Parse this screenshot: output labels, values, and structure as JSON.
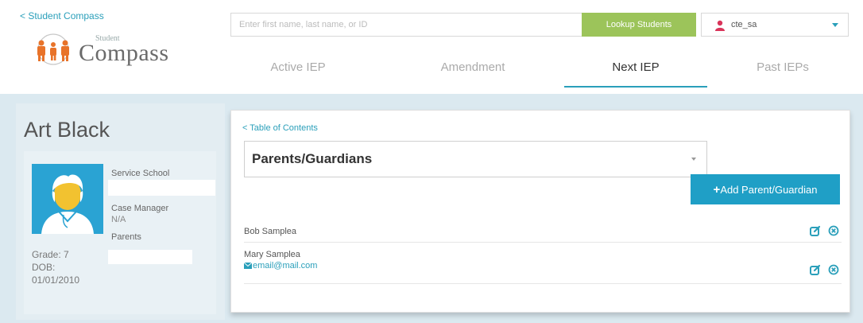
{
  "header": {
    "back_link": "< Student Compass",
    "logo_small": "Student",
    "logo_big": "Compass",
    "search_placeholder": "Enter first name, last name, or ID",
    "lookup_label": "Lookup Students",
    "user_name": "cte_sa"
  },
  "tabs": [
    {
      "label": "Active IEP"
    },
    {
      "label": "Amendment"
    },
    {
      "label": "Next IEP",
      "active": true
    },
    {
      "label": "Past IEPs"
    }
  ],
  "student": {
    "name": "Art Black",
    "service_school_label": "Service School",
    "case_manager_label": "Case Manager",
    "case_manager_value": "N/A",
    "parents_label": "Parents",
    "grade": "Grade: 7",
    "dob_label": "DOB:",
    "dob_value": "01/01/2010"
  },
  "main": {
    "toc_link": "< Table of Contents",
    "section_title": "Parents/Guardians",
    "add_button_label": "Add Parent/Guardian",
    "guardians": [
      {
        "name": "Bob Samplea"
      },
      {
        "name": "Mary Samplea",
        "email": "email@mail.com"
      }
    ]
  },
  "colors": {
    "accent": "#2a9fba",
    "lookup_button": "#9cc45a",
    "add_button": "#1f9fc6",
    "avatar_bg": "#2aa3d3",
    "content_bg": "#dbe9f0"
  }
}
